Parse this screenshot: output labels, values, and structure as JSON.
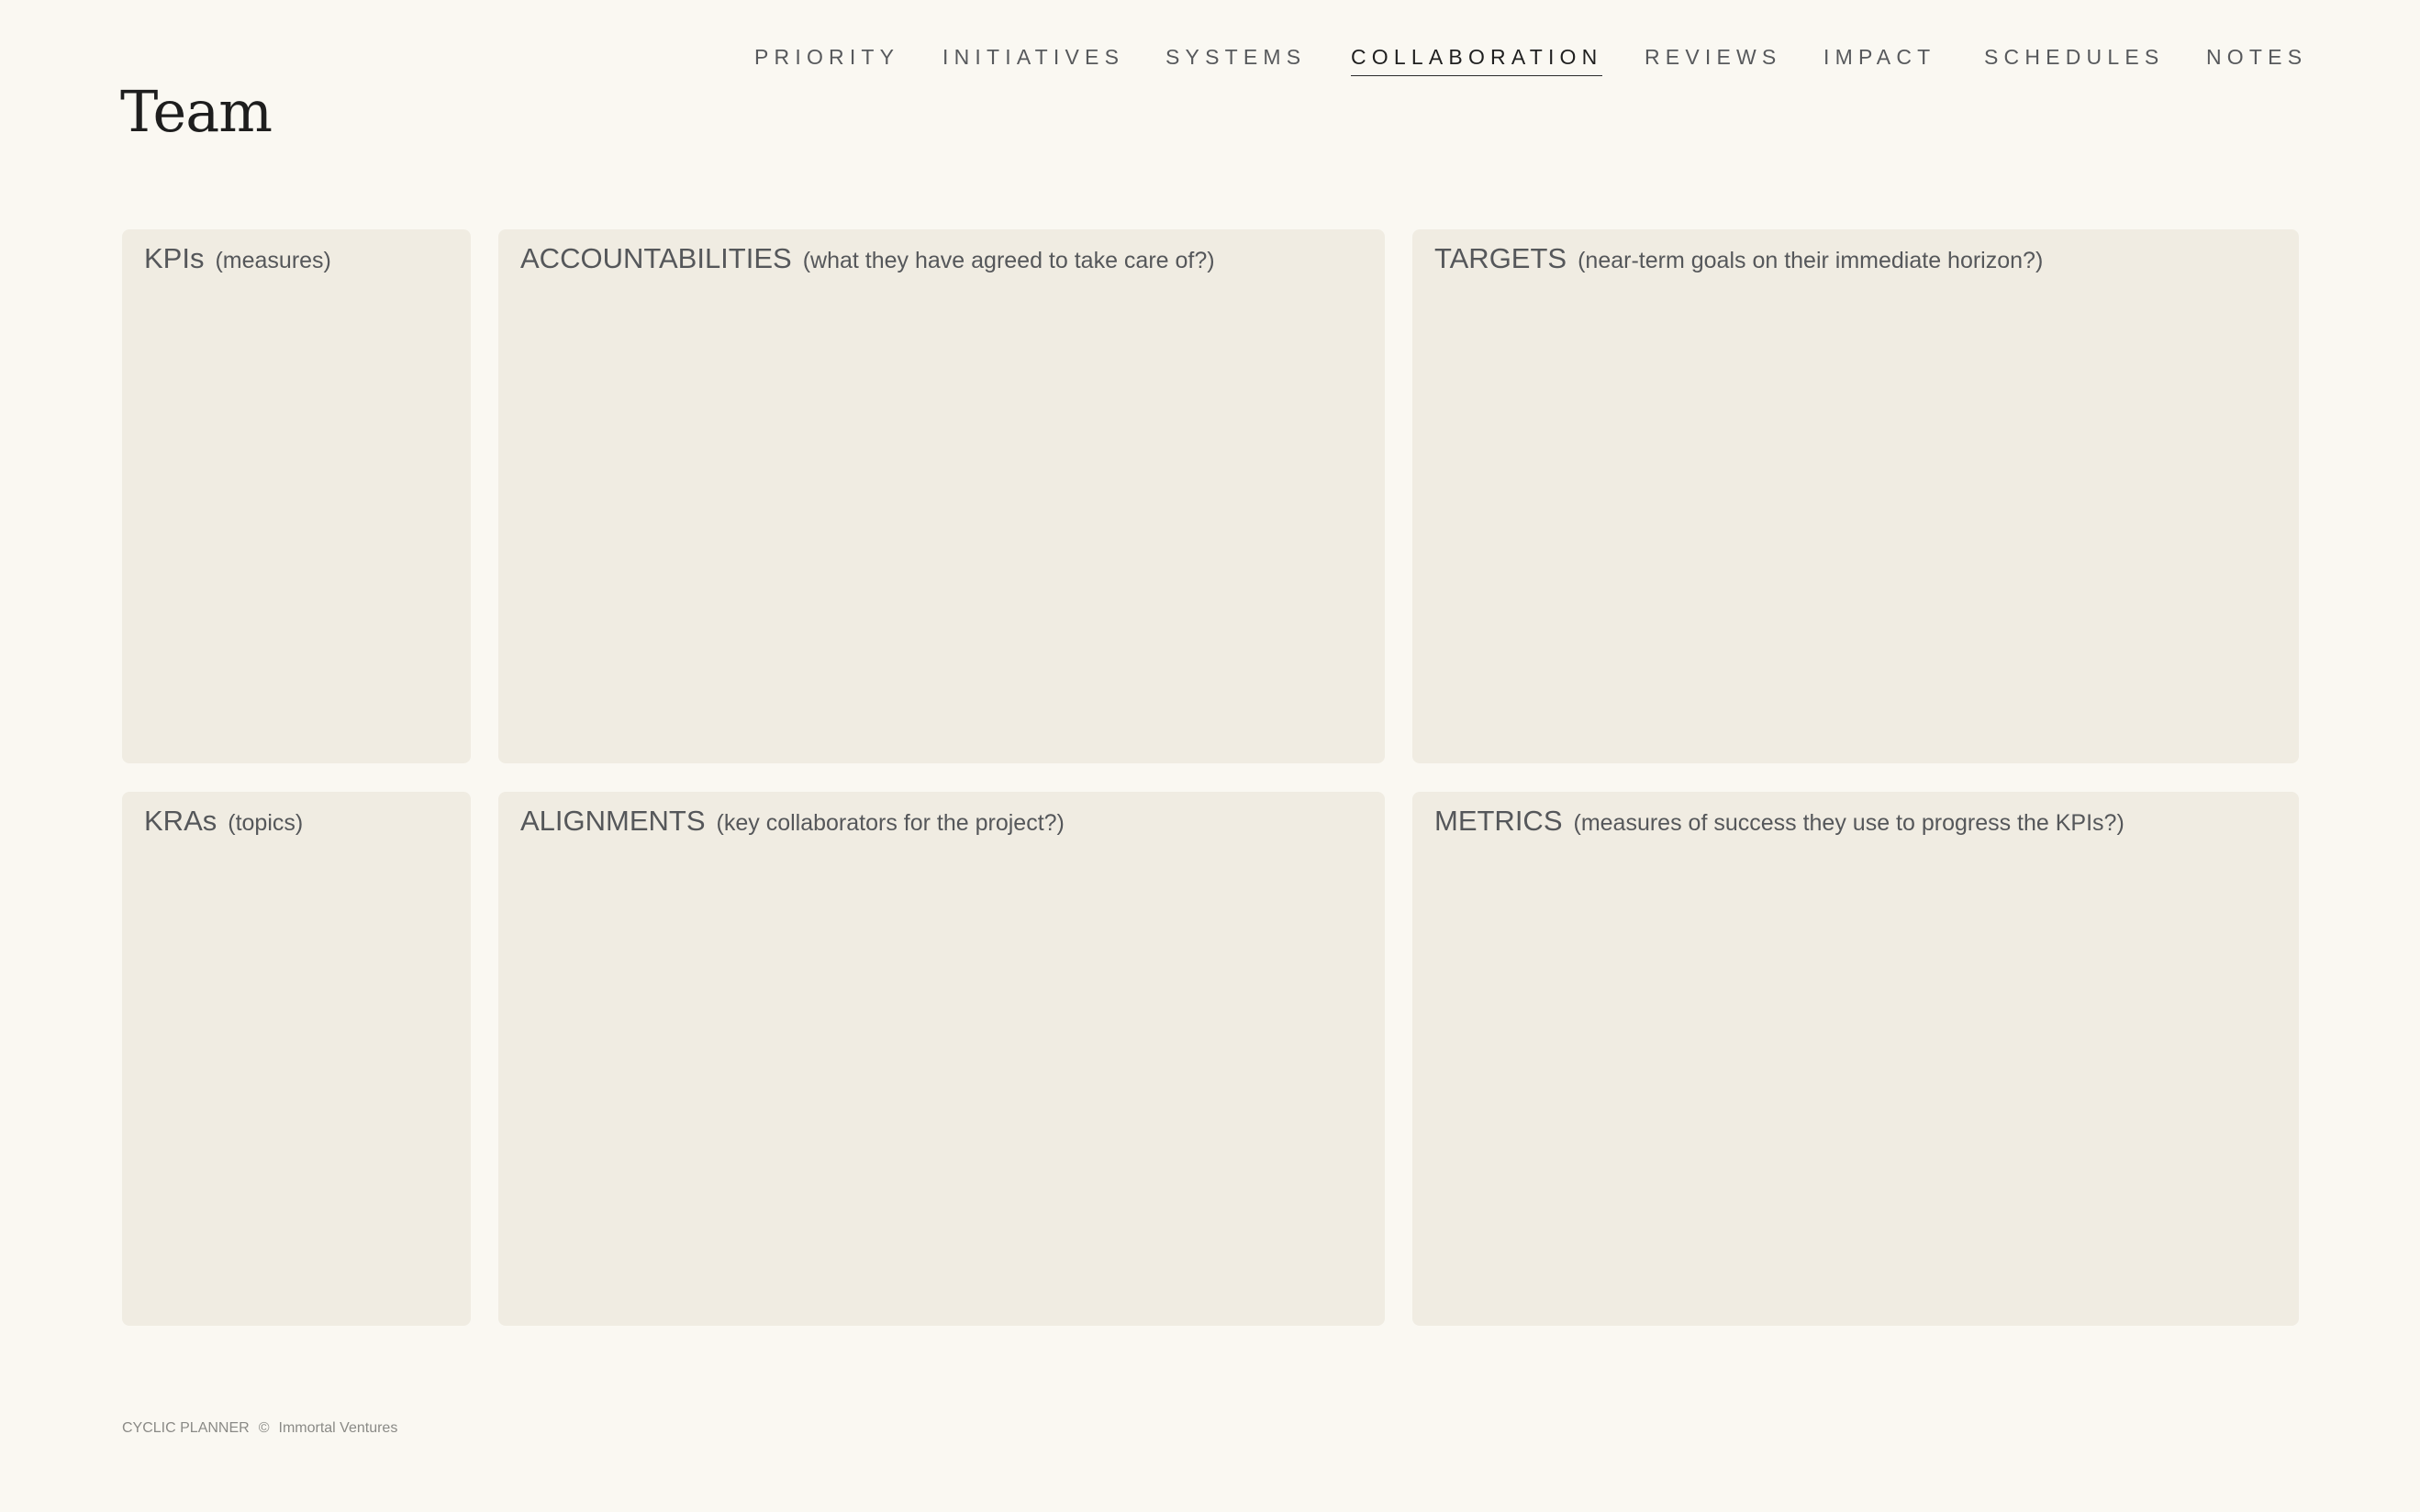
{
  "page": {
    "title": "Team"
  },
  "nav": {
    "items": [
      {
        "label": "PRIORITY"
      },
      {
        "label": "INITIATIVES"
      },
      {
        "label": "SYSTEMS"
      },
      {
        "label": "COLLABORATION",
        "active": true
      },
      {
        "label": "REVIEWS"
      },
      {
        "label": "IMPACT"
      },
      {
        "label": "SCHEDULES"
      },
      {
        "label": "NOTES"
      }
    ]
  },
  "cards": {
    "kpis": {
      "title": "KPIs",
      "hint": "(measures)"
    },
    "accountabilities": {
      "title": "ACCOUNTABILITIES",
      "hint": "(what they have agreed to take care of?)"
    },
    "targets": {
      "title": "TARGETS",
      "hint": "(near-term goals on their immediate horizon?)"
    },
    "kras": {
      "title": "KRAs",
      "hint": "(topics)"
    },
    "alignments": {
      "title": "ALIGNMENTS",
      "hint": "(key collaborators for the project?)"
    },
    "metrics": {
      "title": "METRICS",
      "hint": "(measures of success they use to progress the KPIs?)"
    }
  },
  "footer": {
    "brand": "CYCLIC PLANNER",
    "copyright_symbol": "©",
    "company": "Immortal Ventures"
  },
  "colors": {
    "background": "#faf8f2",
    "card": "#f0ece2",
    "text": "#55575a",
    "title": "#1e1e1e"
  }
}
